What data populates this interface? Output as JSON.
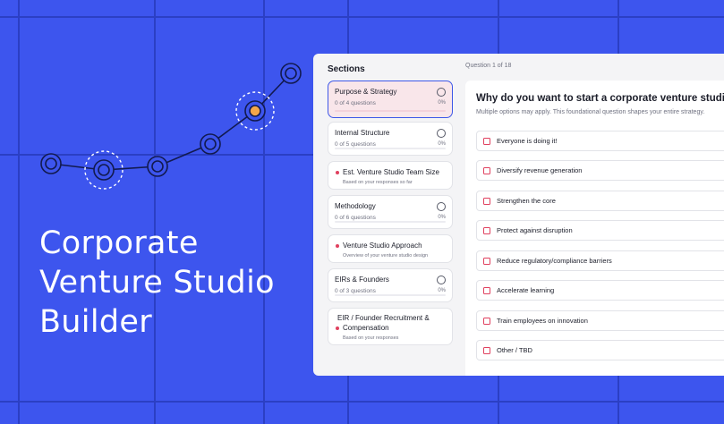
{
  "hero": {
    "line1": "Corporate",
    "line2": "Venture Studio",
    "line3": "Builder"
  },
  "colors": {
    "background": "#3d55ee",
    "accent": "#3d58e8",
    "marker": "#e0405e",
    "highlight_node": "#f4a64a"
  },
  "sidebar": {
    "title": "Sections",
    "items": [
      {
        "name": "Purpose & Strategy",
        "sub": "0 of 4 questions",
        "pct": "0%"
      },
      {
        "name": "Internal Structure",
        "sub": "0 of 5 questions",
        "pct": "0%"
      },
      {
        "name": "Est. Venture Studio Team Size",
        "sub": "Based on your responses so far"
      },
      {
        "name": "Methodology",
        "sub": "0 of 6 questions",
        "pct": "0%"
      },
      {
        "name": "Venture Studio Approach",
        "sub": "Overview of your venture studio design"
      },
      {
        "name": "EIRs & Founders",
        "sub": "0 of 3 questions",
        "pct": "0%"
      },
      {
        "name1": "EIR / Founder Recruitment &",
        "name2": "Compensation",
        "sub": "Based on your responses"
      }
    ]
  },
  "main": {
    "counter": "Question 1 of 18",
    "title": "Why do you want to start a corporate venture studio?",
    "description": "Multiple options may apply. This foundational question shapes your entire strategy.",
    "options": [
      "Everyone is doing it!",
      "Diversify revenue generation",
      "Strengthen the core",
      "Protect against disruption",
      "Reduce regulatory/compliance barriers",
      "Accelerate learning",
      "Train employees on innovation",
      "Other / TBD"
    ]
  }
}
